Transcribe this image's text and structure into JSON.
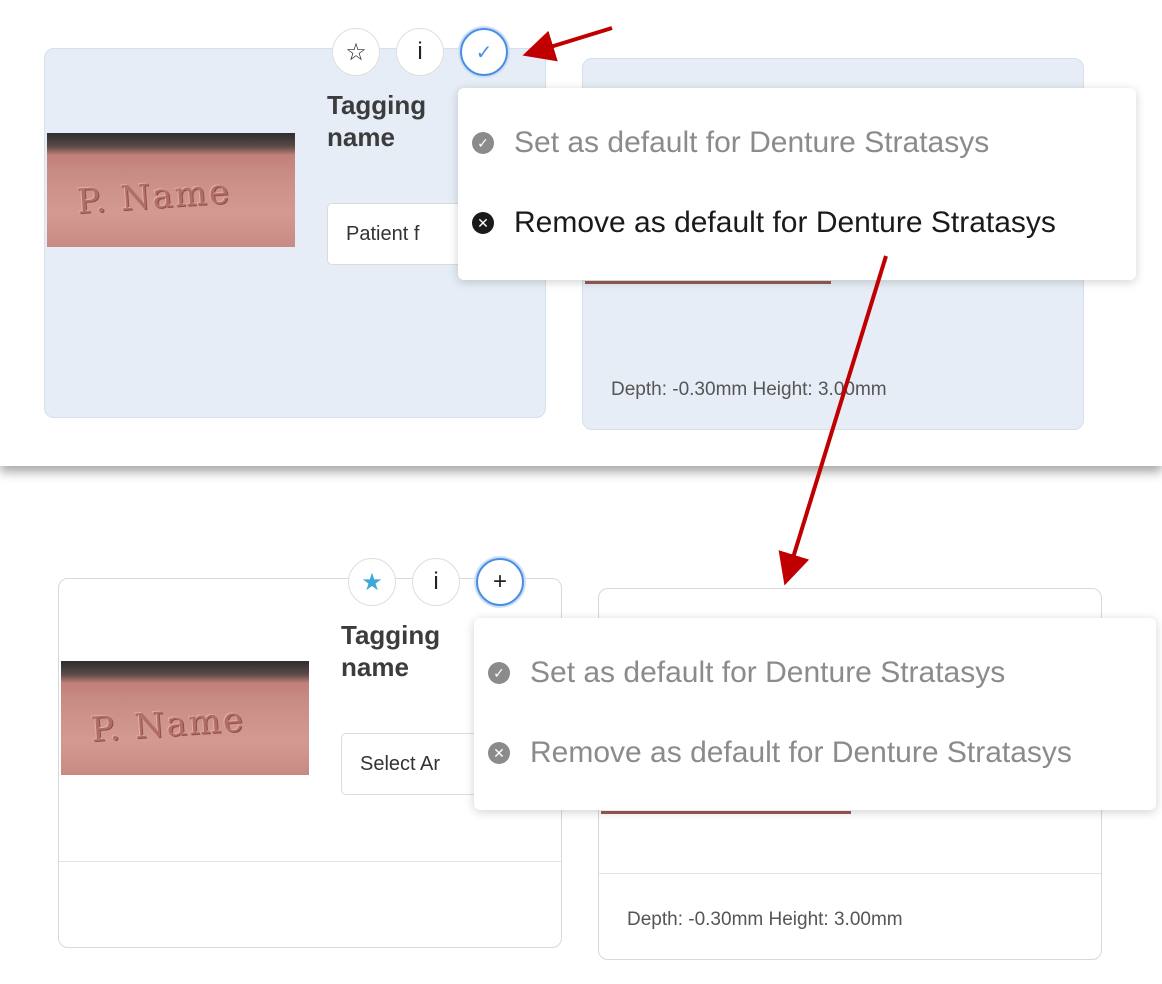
{
  "top_panel": {
    "card_title": "Tagging\nname",
    "select_value": "Patient f",
    "star_icon": "star-outline-icon",
    "info_label": "i",
    "check_icon": "check-icon",
    "menu": {
      "set_default": "Set as default for Denture Stratasys",
      "remove_default": "Remove as default for Denture Stratasys"
    },
    "depth_info": "Depth: -0.30mm Height: 3.00mm"
  },
  "bottom_panel": {
    "card_title": "Tagging\nname",
    "select_value": "Select Ar",
    "star_icon": "star-filled-icon",
    "info_label": "i",
    "add_label": "+",
    "menu": {
      "set_default": "Set as default for Denture Stratasys",
      "remove_default": "Remove as default for Denture Stratasys"
    },
    "depth_info": "Depth: -0.30mm Height: 3.00mm"
  },
  "thumbnail_text": "P. Name",
  "colors": {
    "selected_card_bg": "#e6edf6",
    "accent_blue": "#4a90e2",
    "star_filled": "#3ea8d8",
    "annotation_arrow": "#c00000",
    "muted_text": "#8b8b8b"
  }
}
